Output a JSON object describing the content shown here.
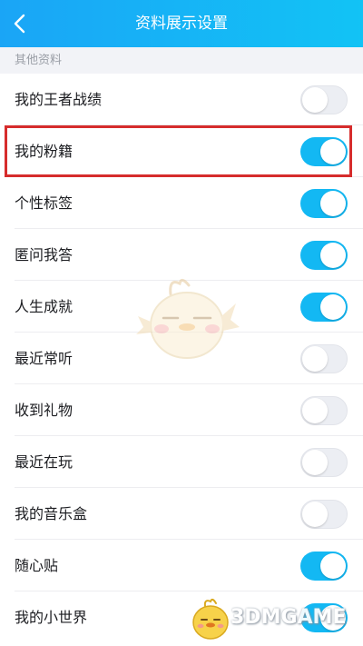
{
  "header": {
    "title": "资料展示设置",
    "background": "#14b6f6",
    "back_icon": "chevron-left-icon"
  },
  "section": {
    "label": "其他资料"
  },
  "items": [
    {
      "label": "我的王者战绩",
      "enabled": false
    },
    {
      "label": "我的粉籍",
      "enabled": true
    },
    {
      "label": "个性标签",
      "enabled": true
    },
    {
      "label": "匿问我答",
      "enabled": true
    },
    {
      "label": "人生成就",
      "enabled": true
    },
    {
      "label": "最近常听",
      "enabled": false
    },
    {
      "label": "收到礼物",
      "enabled": false
    },
    {
      "label": "最近在玩",
      "enabled": false
    },
    {
      "label": "我的音乐盒",
      "enabled": false
    },
    {
      "label": "随心贴",
      "enabled": true
    },
    {
      "label": "我的小世界",
      "enabled": true
    }
  ],
  "colors": {
    "toggle_on": "#13b8f3",
    "toggle_off": "#eceef3",
    "highlight": "#d62c2c"
  },
  "watermark": {
    "text": "3DMGAME"
  }
}
